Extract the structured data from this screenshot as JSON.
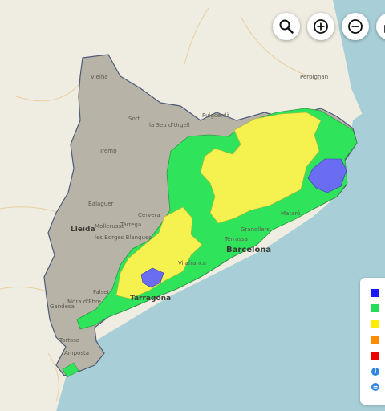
{
  "map": {
    "colors": {
      "sea": "#a8cfd8",
      "land": "#efece2",
      "catalonia_relief": "#b7b4a7",
      "level_green": "#2fe35a",
      "level_yellow": "#f5f24f",
      "level_blue": "#6a6cf2",
      "border": "#4e5b78"
    },
    "labels": {
      "lleida": "Lleida",
      "barcelona": "Barcelona",
      "tarragona": "Tarragona",
      "vielha": "Vielha",
      "sort": "Sort",
      "puigcerda": "Puigcerdà",
      "seu": "la Seu d'Urgell",
      "tremp": "Tremp",
      "balaguer": "Balaguer",
      "cervera": "Cervera",
      "mollerussa": "Mollerussa",
      "tarrega": "Tàrrega",
      "borges": "les Borges Blanques",
      "falset": "Falset",
      "mora": "Móra d'Ebre",
      "gandesa": "Gandesa",
      "tortosa": "Tortosa",
      "amposta": "Amposta",
      "perpignan": "Perpignan",
      "vilafranca": "Vilafranca",
      "granollers": "Granollers",
      "terrassa": "Terrassa",
      "mataro": "Mataró"
    }
  },
  "controls": {
    "search_icon": "magnifier-icon",
    "zoom_in_icon": "zoom-in-icon",
    "zoom_out_icon": "zoom-out-icon",
    "lock_icon": "lock-icon"
  },
  "legend": {
    "levels": [
      {
        "color": "#1a1aff"
      },
      {
        "color": "#22dd55"
      },
      {
        "color": "#ffee00"
      },
      {
        "color": "#ff8c00"
      },
      {
        "color": "#ee0000"
      }
    ],
    "info_icon": "info-icon",
    "layers_icon": "layers-icon"
  }
}
